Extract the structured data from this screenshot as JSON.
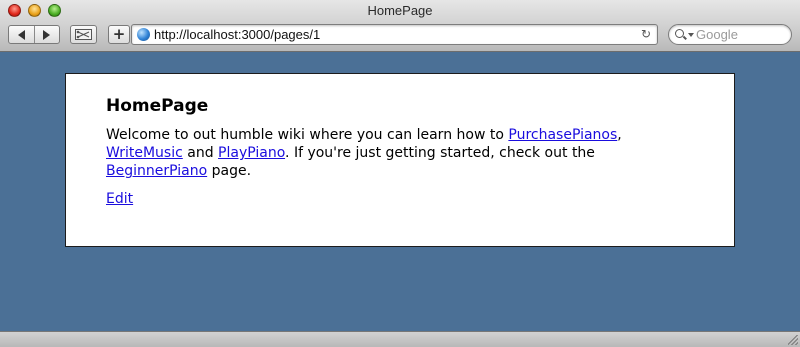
{
  "window": {
    "title": "HomePage"
  },
  "toolbar": {
    "back_icon": "back-arrow-icon",
    "forward_icon": "forward-arrow-icon",
    "snapback_icon": "snapback-icon",
    "add_bookmark_label": "+",
    "url": "http://localhost:3000/pages/1",
    "reload_icon": "↻",
    "search_placeholder": "Google"
  },
  "page": {
    "heading": "HomePage",
    "intro_text_1": "Welcome to out humble wiki where you can learn how to ",
    "link_purchase_pianos": "PurchasePianos",
    "comma": ",",
    "link_write_music": "WriteMusic",
    "and_text": " and ",
    "link_play_piano": "PlayPiano",
    "middle_text": ". If you're just getting started, check out the ",
    "link_beginner_piano": "BeginnerPiano",
    "end_text": " page.",
    "edit_link": "Edit"
  },
  "colors": {
    "background": "#4b7096",
    "link": "#1a0dde",
    "card": "#ffffff"
  }
}
